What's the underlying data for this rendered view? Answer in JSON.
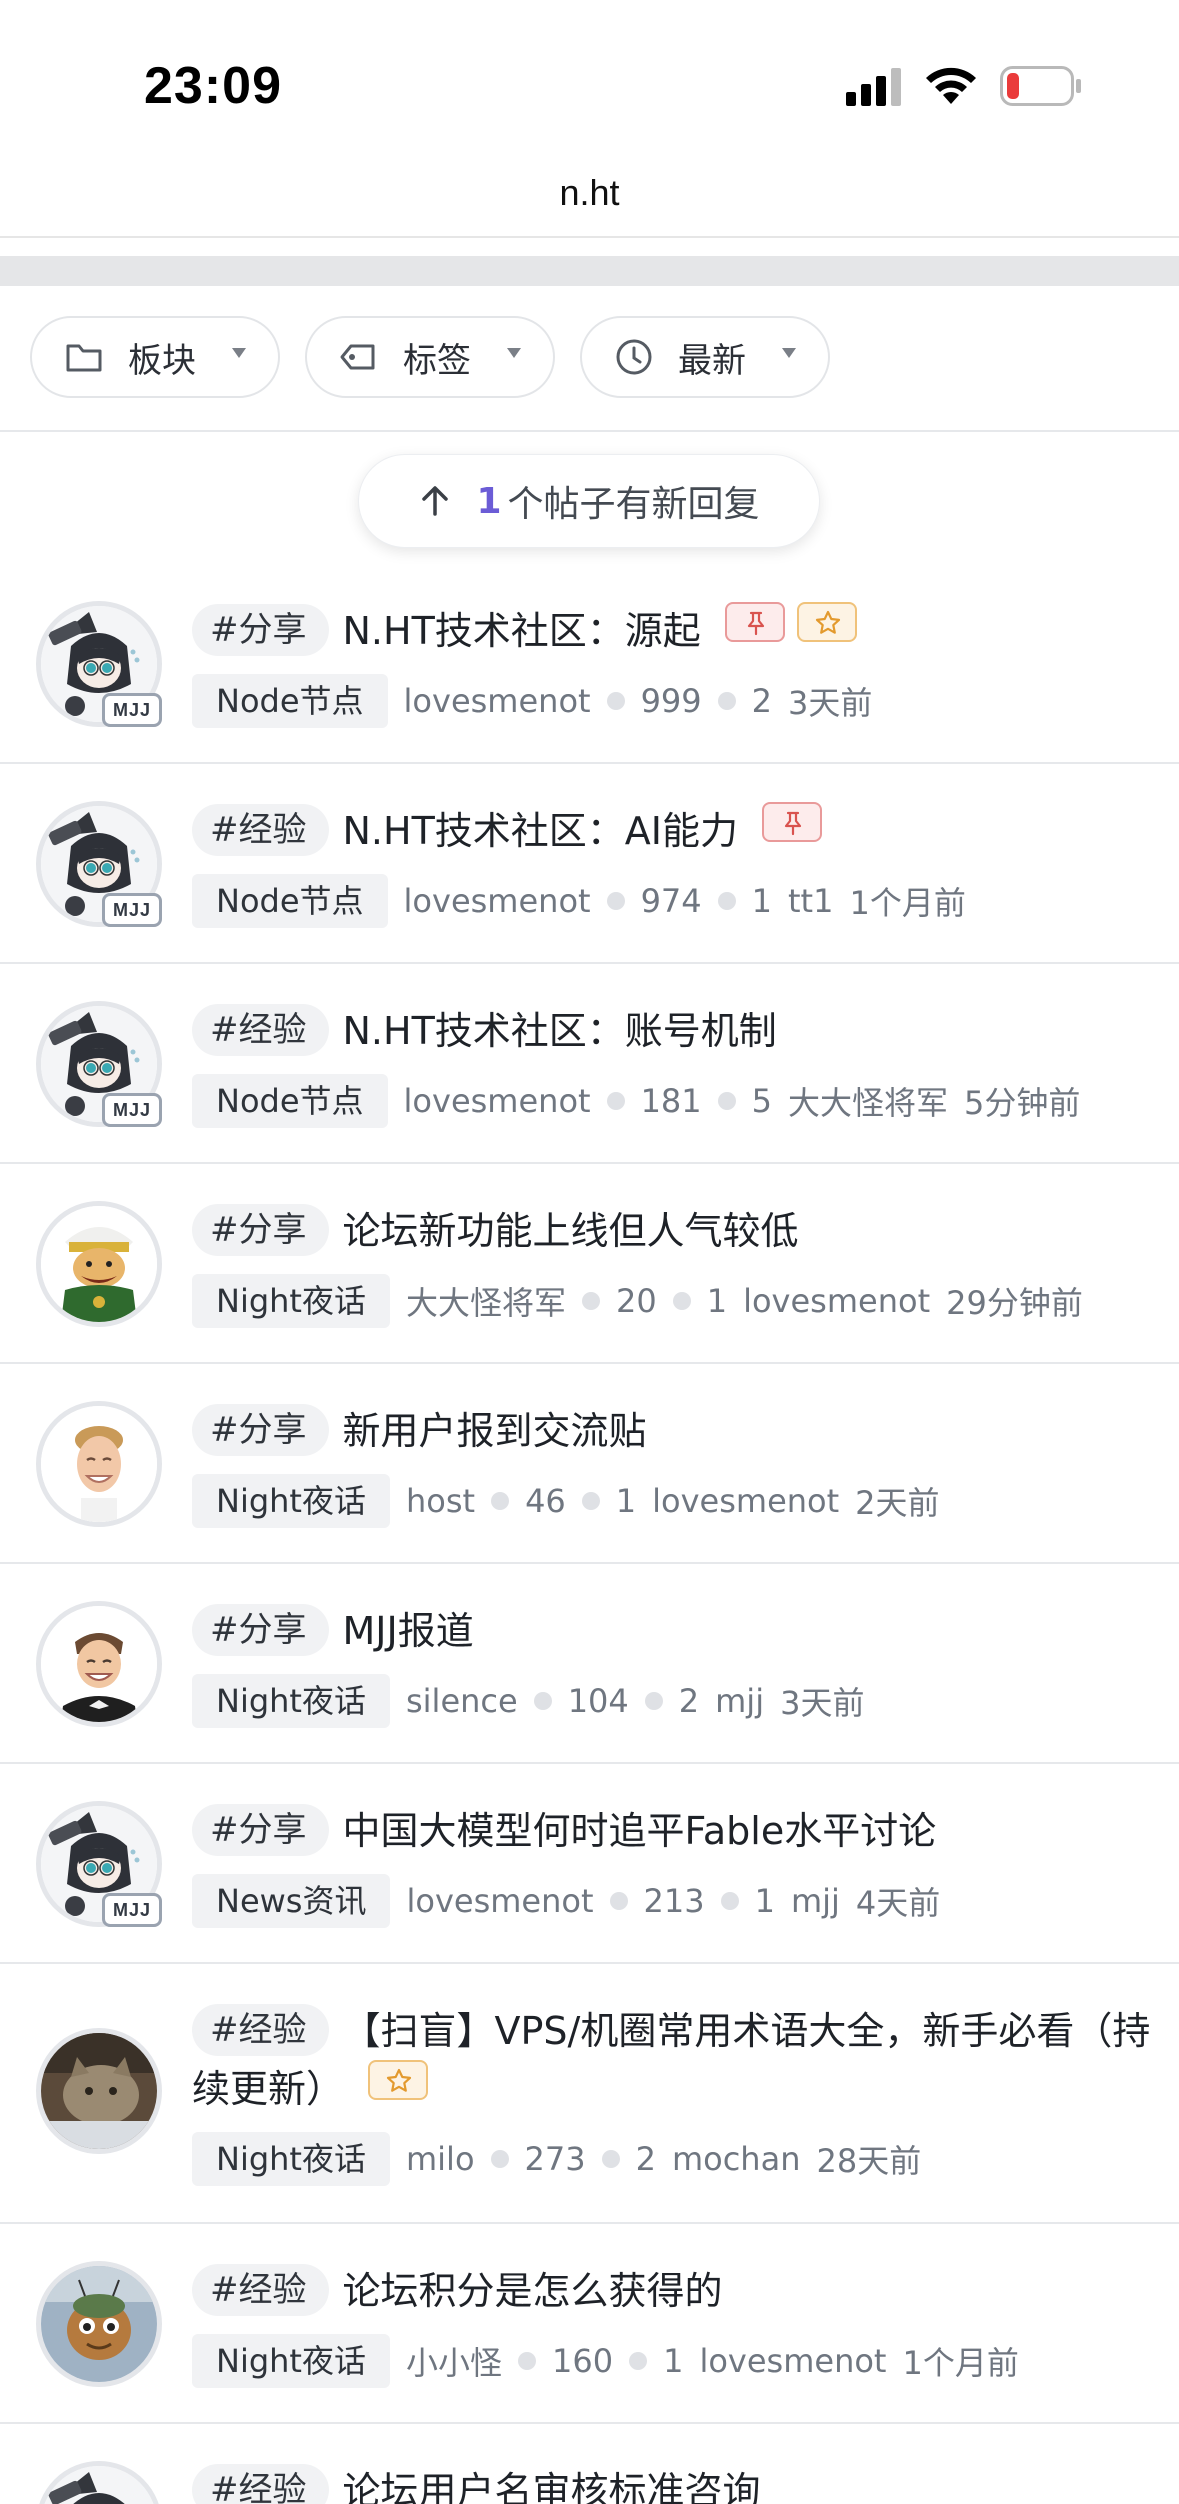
{
  "status": {
    "time": "23:09"
  },
  "browser": {
    "url": "n.ht"
  },
  "filters": [
    {
      "label": "板块",
      "icon": "folder-icon"
    },
    {
      "label": "标签",
      "icon": "tag-icon"
    },
    {
      "label": "最新",
      "icon": "clock-icon"
    }
  ],
  "new_replies": {
    "count": "1",
    "text": "个帖子有新回复"
  },
  "posts": [
    {
      "tag": "#分享",
      "title": "N.HT技术社区：源起",
      "pinned": true,
      "starred": true,
      "category": "Node节点",
      "author": "lovesmenot",
      "views": "999",
      "replies": "2",
      "last_reply_user": "",
      "time": "3天前",
      "avatar": "anime",
      "mjj": true
    },
    {
      "tag": "#经验",
      "title": "N.HT技术社区：AI能力",
      "pinned": true,
      "starred": false,
      "category": "Node节点",
      "author": "lovesmenot",
      "views": "974",
      "replies": "1",
      "last_reply_user": "tt1",
      "time": "1个月前",
      "avatar": "anime",
      "mjj": true
    },
    {
      "tag": "#经验",
      "title": "N.HT技术社区：账号机制",
      "pinned": false,
      "starred": false,
      "category": "Node节点",
      "author": "lovesmenot",
      "views": "181",
      "replies": "5",
      "last_reply_user": "大大怪将军",
      "time": "5分钟前",
      "avatar": "anime",
      "mjj": true
    },
    {
      "tag": "#分享",
      "title": "论坛新功能上线但人气较低",
      "pinned": false,
      "starred": false,
      "category": "Night夜话",
      "author": "大大怪将军",
      "views": "20",
      "replies": "1",
      "last_reply_user": "lovesmenot",
      "time": "29分钟前",
      "avatar": "general",
      "mjj": false
    },
    {
      "tag": "#分享",
      "title": "新用户报到交流贴",
      "pinned": false,
      "starred": false,
      "category": "Night夜话",
      "author": "host",
      "views": "46",
      "replies": "1",
      "last_reply_user": "lovesmenot",
      "time": "2天前",
      "avatar": "blond",
      "mjj": false
    },
    {
      "tag": "#分享",
      "title": "MJJ报道",
      "pinned": false,
      "starred": false,
      "category": "Night夜话",
      "author": "silence",
      "views": "104",
      "replies": "2",
      "last_reply_user": "mjj",
      "time": "3天前",
      "avatar": "batman",
      "mjj": false
    },
    {
      "tag": "#分享",
      "title": "中国大模型何时追平Fable水平讨论",
      "pinned": false,
      "starred": false,
      "category": "News资讯",
      "author": "lovesmenot",
      "views": "213",
      "replies": "1",
      "last_reply_user": "mjj",
      "time": "4天前",
      "avatar": "anime",
      "mjj": true
    },
    {
      "tag": "#经验",
      "title": "【扫盲】VPS/机圈常用术语大全，新手必看（持续更新）",
      "pinned": false,
      "starred": true,
      "category": "Night夜话",
      "author": "milo",
      "views": "273",
      "replies": "2",
      "last_reply_user": "mochan",
      "time": "28天前",
      "avatar": "cat",
      "mjj": false
    },
    {
      "tag": "#经验",
      "title": "论坛积分是怎么获得的",
      "pinned": false,
      "starred": false,
      "category": "Night夜话",
      "author": "小小怪",
      "views": "160",
      "replies": "1",
      "last_reply_user": "lovesmenot",
      "time": "1个月前",
      "avatar": "alien",
      "mjj": false
    },
    {
      "tag": "#经验",
      "title": "论坛用户名审核标准咨询",
      "pinned": false,
      "starred": false,
      "category": "",
      "author": "",
      "views": "",
      "replies": "",
      "last_reply_user": "",
      "time": "",
      "avatar": "anime",
      "mjj": false
    }
  ]
}
